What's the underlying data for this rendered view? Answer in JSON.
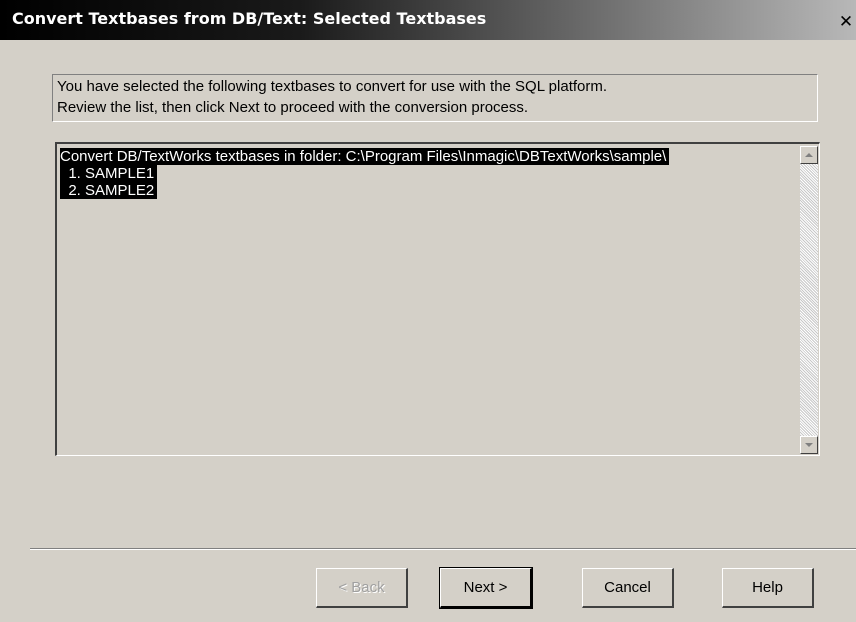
{
  "window": {
    "title": "Convert Textbases from DB/Text: Selected Textbases",
    "close_glyph": "✕"
  },
  "info": {
    "line1": "You have selected the following textbases to convert for use with the  SQL platform.",
    "line2": "Review the list, then click Next to proceed with the conversion process."
  },
  "list": {
    "items": [
      "Convert DB/TextWorks textbases in folder: C:\\Program Files\\Inmagic\\DBTextWorks\\sample\\",
      "  1. SAMPLE1",
      "  2. SAMPLE2"
    ]
  },
  "buttons": {
    "back": "< Back",
    "next": "Next >",
    "cancel": "Cancel",
    "help": "Help"
  },
  "icons": {
    "close": "close-icon",
    "scroll_up": "scroll-up-arrow-icon",
    "scroll_down": "scroll-down-arrow-icon"
  }
}
